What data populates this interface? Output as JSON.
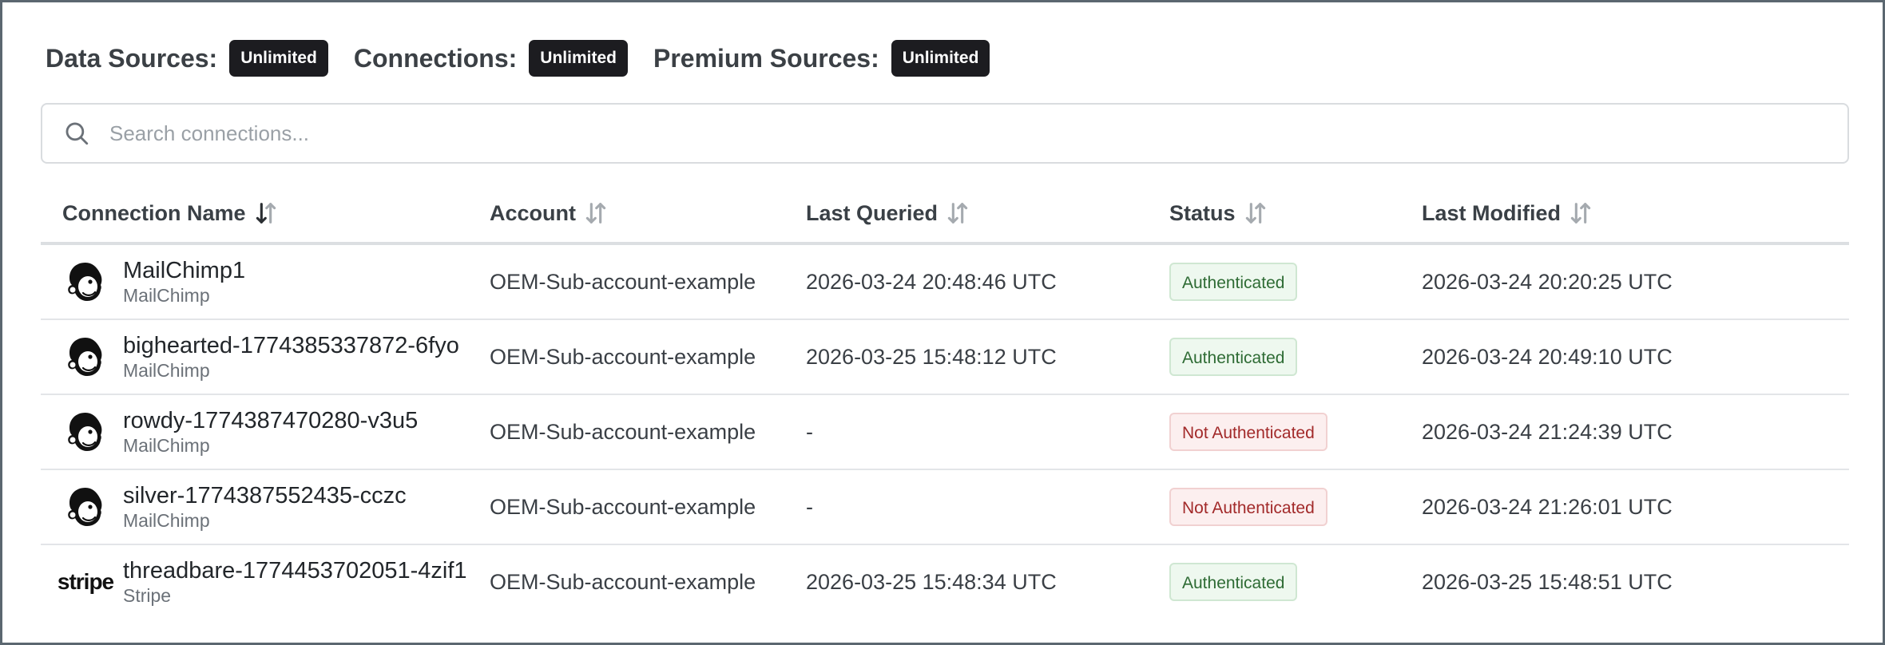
{
  "limits": [
    {
      "label": "Data Sources:",
      "value": "Unlimited"
    },
    {
      "label": "Connections:",
      "value": "Unlimited"
    },
    {
      "label": "Premium Sources:",
      "value": "Unlimited"
    }
  ],
  "search": {
    "placeholder": "Search connections...",
    "value": ""
  },
  "table": {
    "columns": [
      {
        "label": "Connection Name",
        "sort": "descending"
      },
      {
        "label": "Account",
        "sort": "none"
      },
      {
        "label": "Last Queried",
        "sort": "none"
      },
      {
        "label": "Status",
        "sort": "none"
      },
      {
        "label": "Last Modified",
        "sort": "none"
      }
    ],
    "rows": [
      {
        "logo": "mailchimp-icon",
        "name": "MailChimp1",
        "type": "MailChimp",
        "account": "OEM-Sub-account-example",
        "last_queried": "2026-03-24 20:48:46 UTC",
        "status": "Authenticated",
        "last_modified": "2026-03-24 20:20:25 UTC"
      },
      {
        "logo": "mailchimp-icon",
        "name": "bighearted-1774385337872-6fyo",
        "type": "MailChimp",
        "account": "OEM-Sub-account-example",
        "last_queried": "2026-03-25 15:48:12 UTC",
        "status": "Authenticated",
        "last_modified": "2026-03-24 20:49:10 UTC"
      },
      {
        "logo": "mailchimp-icon",
        "name": "rowdy-1774387470280-v3u5",
        "type": "MailChimp",
        "account": "OEM-Sub-account-example",
        "last_queried": "-",
        "status": "Not Authenticated",
        "last_modified": "2026-03-24 21:24:39 UTC"
      },
      {
        "logo": "mailchimp-icon",
        "name": "silver-1774387552435-cczc",
        "type": "MailChimp",
        "account": "OEM-Sub-account-example",
        "last_queried": "-",
        "status": "Not Authenticated",
        "last_modified": "2026-03-24 21:26:01 UTC"
      },
      {
        "logo": "stripe-logo",
        "logo_text": "stripe",
        "name": "threadbare-1774453702051-4zif1",
        "type": "Stripe",
        "account": "OEM-Sub-account-example",
        "last_queried": "2026-03-25 15:48:34 UTC",
        "status": "Authenticated",
        "last_modified": "2026-03-25 15:48:51 UTC"
      }
    ]
  },
  "colors": {
    "badge_dark": "#1c1c20",
    "status_ok_bg": "#eef8ef",
    "status_ok_text": "#2e6b34",
    "status_bad_bg": "#fcefef",
    "status_bad_text": "#a22a2a"
  }
}
